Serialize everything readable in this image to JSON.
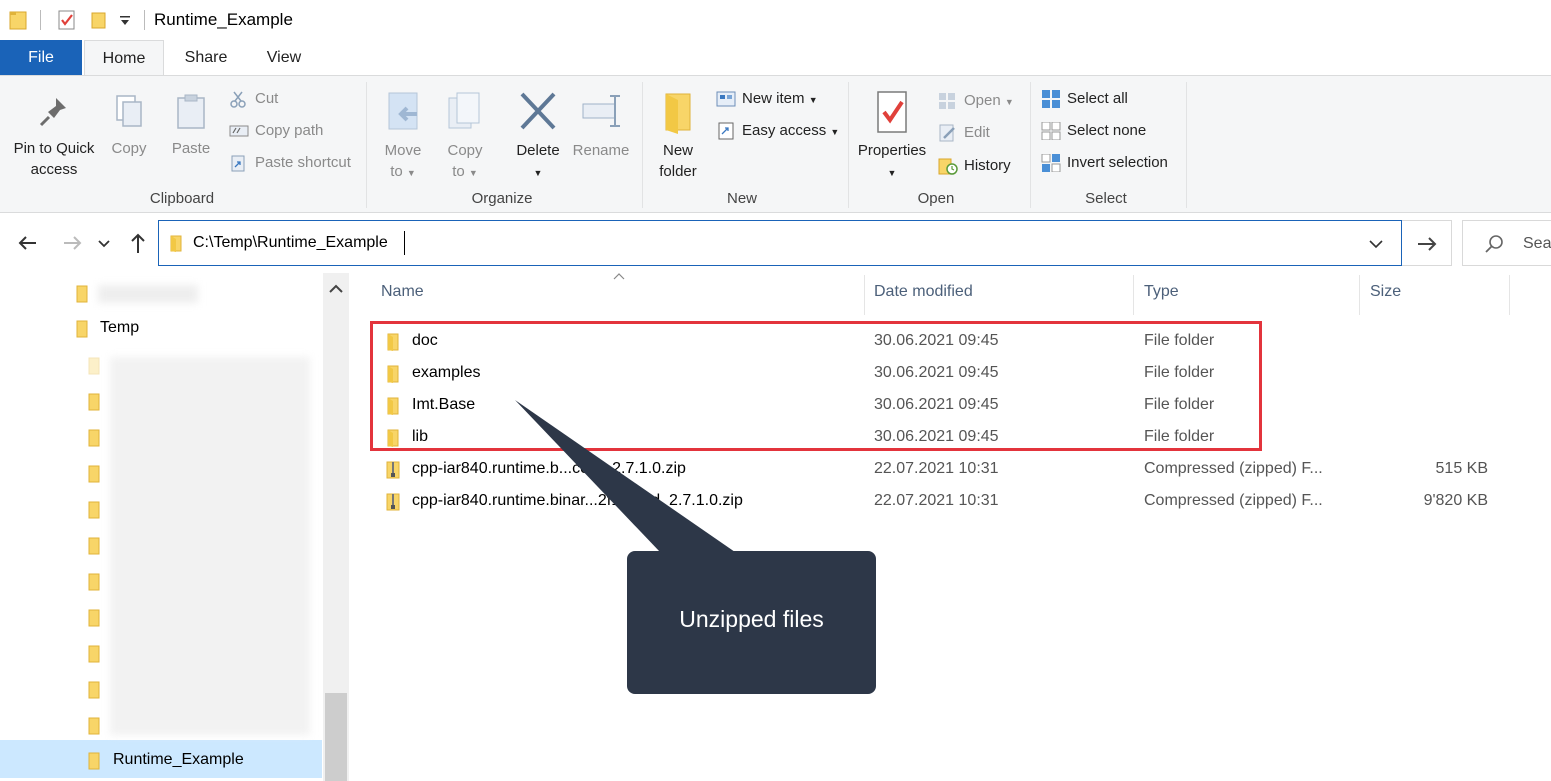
{
  "window": {
    "title": "Runtime_Example"
  },
  "tabs": [
    {
      "label": "File"
    },
    {
      "label": "Home"
    },
    {
      "label": "Share"
    },
    {
      "label": "View"
    }
  ],
  "ribbon": {
    "clipboard": {
      "group_label": "Clipboard",
      "pin_line1": "Pin to Quick",
      "pin_line2": "access",
      "copy": "Copy",
      "paste": "Paste",
      "cut": "Cut",
      "copy_path": "Copy path",
      "paste_shortcut": "Paste shortcut"
    },
    "organize": {
      "group_label": "Organize",
      "move_line1": "Move",
      "move_line2": "to",
      "copy_line1": "Copy",
      "copy_line2": "to",
      "delete": "Delete",
      "rename": "Rename"
    },
    "new": {
      "group_label": "New",
      "new_folder_line1": "New",
      "new_folder_line2": "folder",
      "new_item": "New item",
      "easy_access": "Easy access"
    },
    "open": {
      "group_label": "Open",
      "properties": "Properties",
      "open": "Open",
      "edit": "Edit",
      "history": "History"
    },
    "select": {
      "group_label": "Select",
      "select_all": "Select all",
      "select_none": "Select none",
      "invert_selection": "Invert selection"
    }
  },
  "address": {
    "path": "C:\\Temp\\Runtime_Example",
    "search_placeholder": "Sea"
  },
  "navpane": {
    "items": [
      {
        "label": "Temp"
      },
      {
        "label": "Runtime_Example"
      }
    ]
  },
  "filelist": {
    "columns": {
      "name": "Name",
      "date": "Date modified",
      "type": "Type",
      "size": "Size"
    },
    "rows": [
      {
        "name": "doc",
        "date": "30.06.2021 09:45",
        "type": "File folder",
        "size": "",
        "kind": "folder"
      },
      {
        "name": "examples",
        "date": "30.06.2021 09:45",
        "type": "File folder",
        "size": "",
        "kind": "folder"
      },
      {
        "name": "Imt.Base",
        "date": "30.06.2021 09:45",
        "type": "File folder",
        "size": "",
        "kind": "folder"
      },
      {
        "name": "lib",
        "date": "30.06.2021 09:45",
        "type": "File folder",
        "size": "",
        "kind": "folder"
      },
      {
        "name": "cpp-iar840.runtime.b...core_2.7.1.0.zip",
        "date": "22.07.2021 10:31",
        "type": "Compressed (zipped) F...",
        "size": "515 KB",
        "kind": "zip"
      },
      {
        "name": "cpp-iar840.runtime.binar...2f103md_2.7.1.0.zip",
        "date": "22.07.2021 10:31",
        "type": "Compressed (zipped) F...",
        "size": "9'820 KB",
        "kind": "zip"
      }
    ]
  },
  "annotation": {
    "callout_text": "Unzipped files"
  },
  "colors": {
    "accent": "#1a63b8",
    "highlight": "#e3343c",
    "callout": "#2d3748",
    "folder": "#f8d568"
  }
}
